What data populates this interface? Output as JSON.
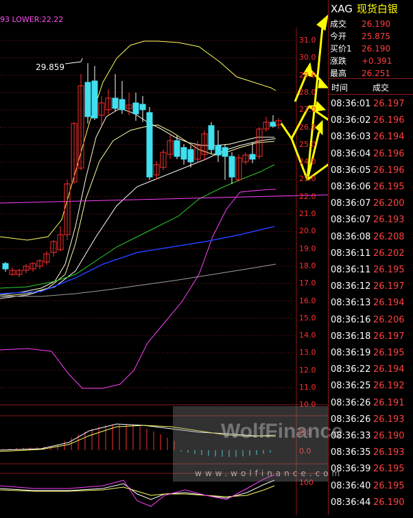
{
  "legend": {
    "prefix": "93",
    "label": "LOWER:22.22"
  },
  "annotation": "29.859",
  "axis_ticks": [
    "31.0",
    "30.0",
    "29.0",
    "28.0",
    "27.0",
    "26.0",
    "25.0",
    "24.0",
    "23.0",
    "22.0",
    "21.0",
    "20.0",
    "19.0",
    "18.0",
    "17.0",
    "16.0",
    "15.0",
    "14.0",
    "13.0",
    "12.0",
    "11.0",
    "10.0"
  ],
  "sub_axis": {
    "macd_zero": "0.0",
    "macd_top": "2.0",
    "kdj_top": "100"
  },
  "watermark": {
    "brand": "WolfFinance",
    "url": "www.wolfinance.com"
  },
  "quote": {
    "symbol": "XAG",
    "name": "现货白银",
    "rows": [
      {
        "label": "成交",
        "value": "26.190"
      },
      {
        "label": "今开",
        "value": "25.875"
      },
      {
        "label": "买价1",
        "value": "26.190"
      },
      {
        "label": "涨跌",
        "value": "+0.391"
      },
      {
        "label": "最高",
        "value": "26.251"
      }
    ],
    "table_header": {
      "time": "时间",
      "price": "成交"
    },
    "ticks": [
      {
        "time": "08:36:01",
        "price": "26.197"
      },
      {
        "time": "08:36:02",
        "price": "26.196"
      },
      {
        "time": "08:36:03",
        "price": "26.194"
      },
      {
        "time": "08:36:04",
        "price": "26.196"
      },
      {
        "time": "08:36:05",
        "price": "26.196"
      },
      {
        "time": "08:36:06",
        "price": "26.195"
      },
      {
        "time": "08:36:07",
        "price": "26.200"
      },
      {
        "time": "08:36:07",
        "price": "26.193"
      },
      {
        "time": "08:36:08",
        "price": "26.208"
      },
      {
        "time": "08:36:11",
        "price": "26.202"
      },
      {
        "time": "08:36:11",
        "price": "26.195"
      },
      {
        "time": "08:36:12",
        "price": "26.197"
      },
      {
        "time": "08:36:13",
        "price": "26.194"
      },
      {
        "time": "08:36:16",
        "price": "26.206"
      },
      {
        "time": "08:36:18",
        "price": "26.197"
      },
      {
        "time": "08:36:19",
        "price": "26.195"
      },
      {
        "time": "08:36:22",
        "price": "26.194"
      },
      {
        "time": "08:36:25",
        "price": "26.192"
      },
      {
        "time": "08:36:26",
        "price": "26.191"
      },
      {
        "time": "08:36:26",
        "price": "26.193"
      },
      {
        "time": "08:36:33",
        "price": "26.190"
      },
      {
        "time": "08:36:35",
        "price": "26.193"
      },
      {
        "time": "08:36:39",
        "price": "26.195"
      },
      {
        "time": "08:36:40",
        "price": "26.195"
      },
      {
        "time": "08:36:44",
        "price": "26.190"
      }
    ]
  },
  "colors": {
    "up": "#ff3030",
    "down": "#40e0f0",
    "ma_yellow": "#ffff60",
    "ma_green": "#30d030",
    "ma_blue": "#2040ff",
    "ma_gray": "#a0a0a0",
    "boll_magenta": "#ff40ff",
    "arrow": "#ffff00"
  }
}
